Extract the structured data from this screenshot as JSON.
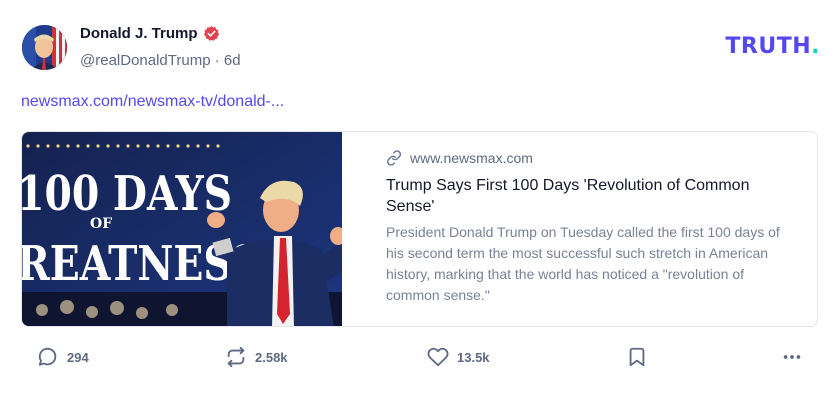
{
  "author": {
    "display_name": "Donald J. Trump",
    "handle": "@realDonaldTrump",
    "separator": "·",
    "time_ago": "6d",
    "verified_color": "#e0444e"
  },
  "brand": {
    "name": "TRUTH",
    "dot": ".",
    "color": "#5448ee",
    "dot_color": "#17d1c6"
  },
  "post": {
    "link_text": "newsmax.com/newsmax-tv/donald-..."
  },
  "card": {
    "domain": "www.newsmax.com",
    "title": "Trump Says First 100 Days 'Revolution of Common Sense'",
    "description": "President Donald Trump on Tuesday called the first 100 days of his second term the most successful such stretch in American history, marking that the world has noticed a \"revolution of common sense.\"",
    "image_text_line1": "100 DAYS",
    "image_text_line2": "OF",
    "image_text_line3": "REATNESS"
  },
  "actions": {
    "replies": "294",
    "reposts": "2.58k",
    "likes": "13.5k"
  }
}
